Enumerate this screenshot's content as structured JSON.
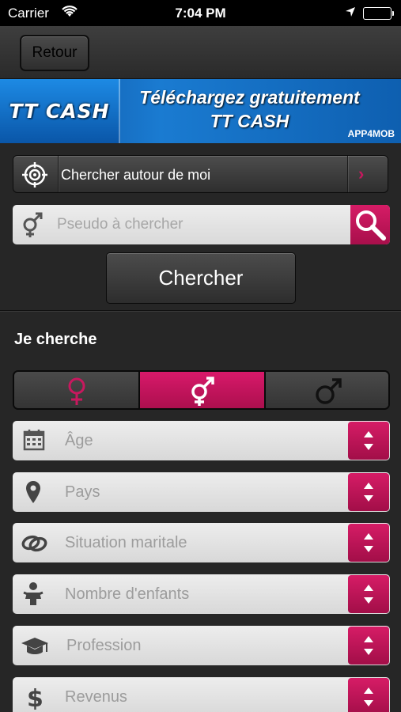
{
  "status_bar": {
    "carrier": "Carrier",
    "time": "7:04 PM"
  },
  "navbar": {
    "back_label": "Retour"
  },
  "banner": {
    "logo_text": "TT CASH",
    "headline_line1": "Téléchargez gratuitement",
    "headline_line2": "TT CASH",
    "brand": "APP4MOB"
  },
  "search_near": {
    "label": "Chercher autour de moi"
  },
  "pseudo_search": {
    "placeholder": "Pseudo à chercher"
  },
  "search_button": {
    "label": "Chercher"
  },
  "filters_section": {
    "title": "Je cherche",
    "gender_options": [
      "female",
      "both",
      "male"
    ],
    "selected_gender": "both",
    "fields": [
      {
        "icon": "calendar-icon",
        "placeholder": "Âge"
      },
      {
        "icon": "location-pin-icon",
        "placeholder": "Pays"
      },
      {
        "icon": "rings-icon",
        "placeholder": "Situation maritale"
      },
      {
        "icon": "baby-icon",
        "placeholder": "Nombre d'enfants"
      },
      {
        "icon": "graduation-cap-icon",
        "placeholder": "Profession"
      },
      {
        "icon": "dollar-icon",
        "placeholder": "Revenus"
      }
    ]
  },
  "colors": {
    "accent": "#c8185e",
    "background": "#262626"
  }
}
